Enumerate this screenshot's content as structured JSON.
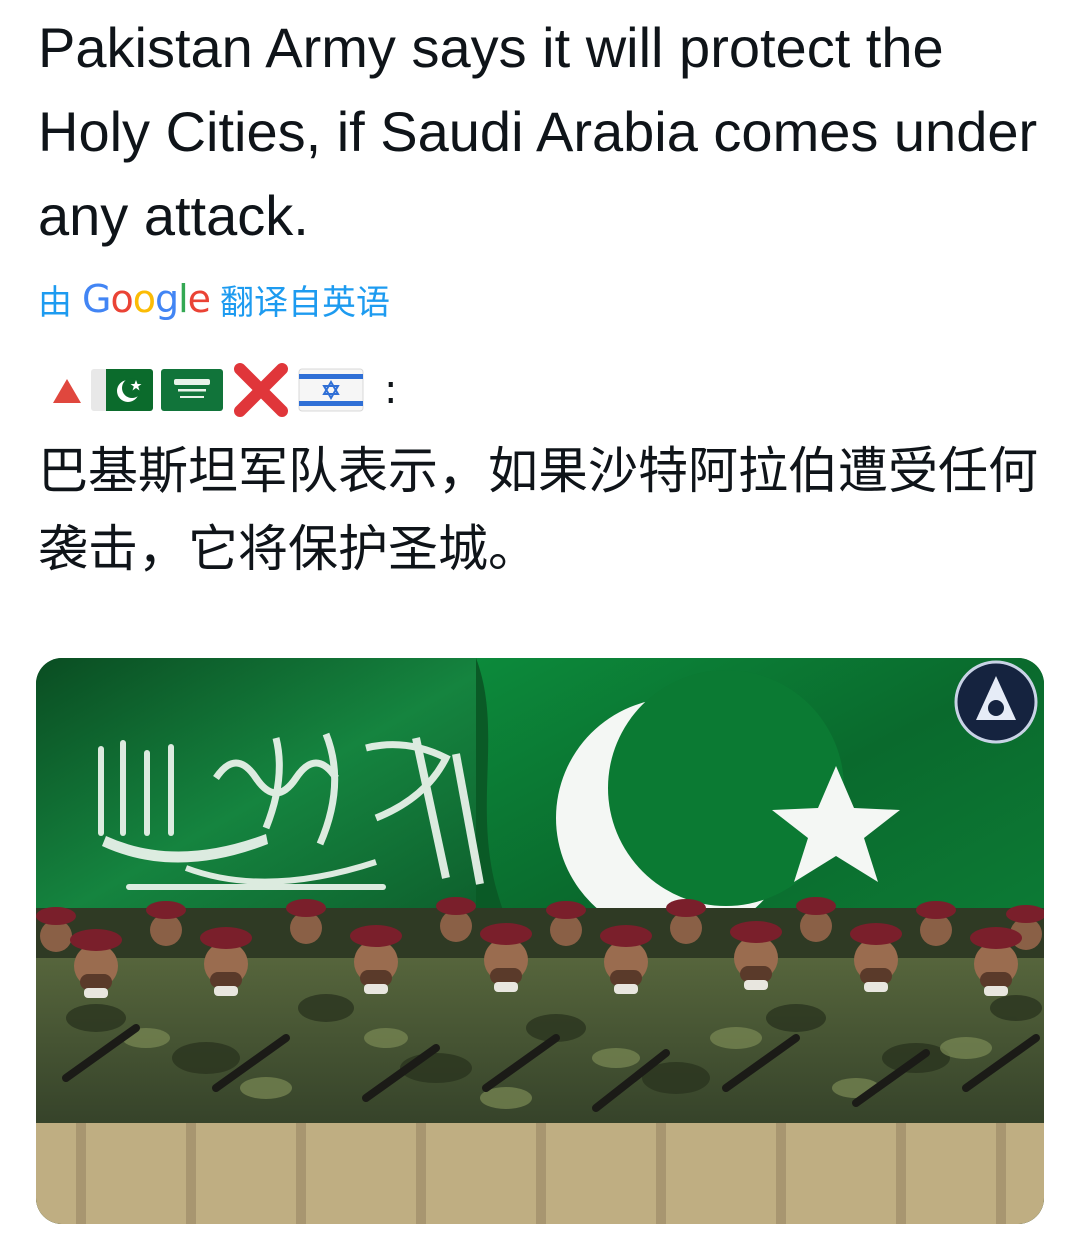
{
  "post": {
    "text": "Pakistan Army says it will protect the Holy Cities, if Saudi Arabia comes under any attack."
  },
  "translation": {
    "prefix": "由",
    "provider": "Google",
    "suffix": "翻译自英语"
  },
  "emoji_line": {
    "icons": [
      "red-triangle-icon",
      "pakistan-flag-icon",
      "saudi-flag-icon",
      "cross-mark-icon",
      "israel-flag-icon"
    ],
    "separator": ":"
  },
  "translated_text": "巴基斯坦军队表示，如果沙特阿拉伯遭受任何袭击，它将保护圣城。",
  "media": {
    "image": "Saudi and Pakistan flags above marching soldiers in maroon berets",
    "colors": {
      "saudi_green": "#0d6b2e",
      "pakistan_green": "#0b7a33",
      "beret": "#7a1f2b",
      "uniform": "#4b5a36",
      "trousers": "#cbb98e"
    }
  }
}
